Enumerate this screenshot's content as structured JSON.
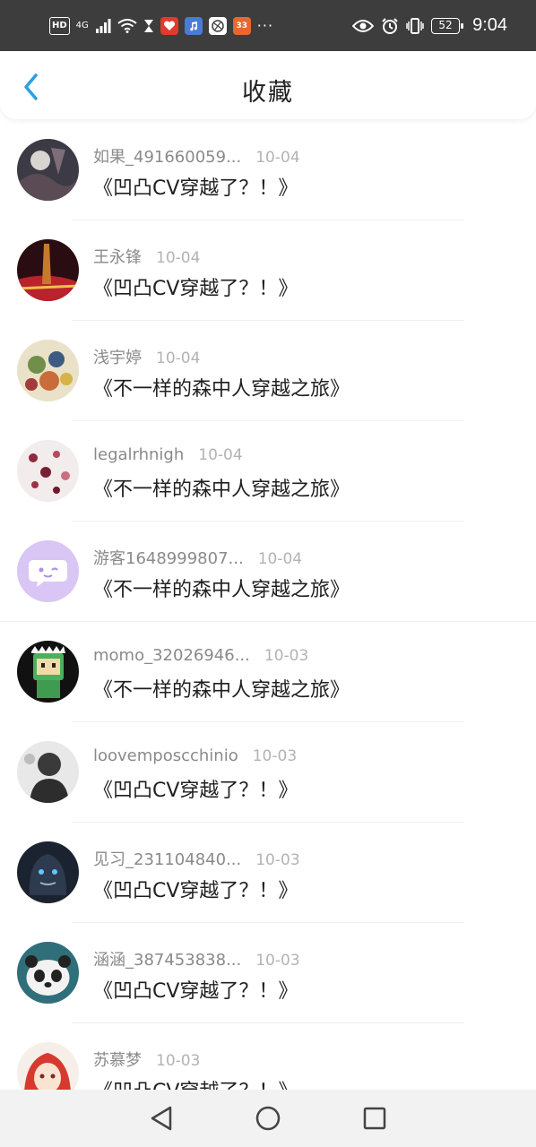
{
  "status_bar": {
    "hd": "HD",
    "network": "4G",
    "app_badge": "33",
    "more": "···",
    "battery": "52",
    "time": "9:04"
  },
  "header": {
    "title": "收藏"
  },
  "items": [
    {
      "username": "如果_491660059...",
      "date": "10-04",
      "title": "《凹凸CV穿越了？！》"
    },
    {
      "username": "王永锋",
      "date": "10-04",
      "title": "《凹凸CV穿越了？！》"
    },
    {
      "username": "浅宇婷",
      "date": "10-04",
      "title": "《不一样的森中人穿越之旅》"
    },
    {
      "username": "legalrhnigh",
      "date": "10-04",
      "title": "《不一样的森中人穿越之旅》"
    },
    {
      "username": "游客1648999807...",
      "date": "10-04",
      "title": "《不一样的森中人穿越之旅》"
    },
    {
      "username": "momo_32026946...",
      "date": "10-03",
      "title": "《不一样的森中人穿越之旅》"
    },
    {
      "username": "loovemposcchinio",
      "date": "10-03",
      "title": "《凹凸CV穿越了？！》"
    },
    {
      "username": "见习_231104840...",
      "date": "10-03",
      "title": "《凹凸CV穿越了？！》"
    },
    {
      "username": "涵涵_387453838...",
      "date": "10-03",
      "title": "《凹凸CV穿越了？！》"
    },
    {
      "username": "苏慕梦",
      "date": "10-03",
      "title": "《凹凸CV穿越了？！》"
    }
  ],
  "colors": {
    "accent": "#2a9ee8",
    "status_bar_bg": "#3d3d3d",
    "nav_bar_bg": "#f2f2f2"
  }
}
